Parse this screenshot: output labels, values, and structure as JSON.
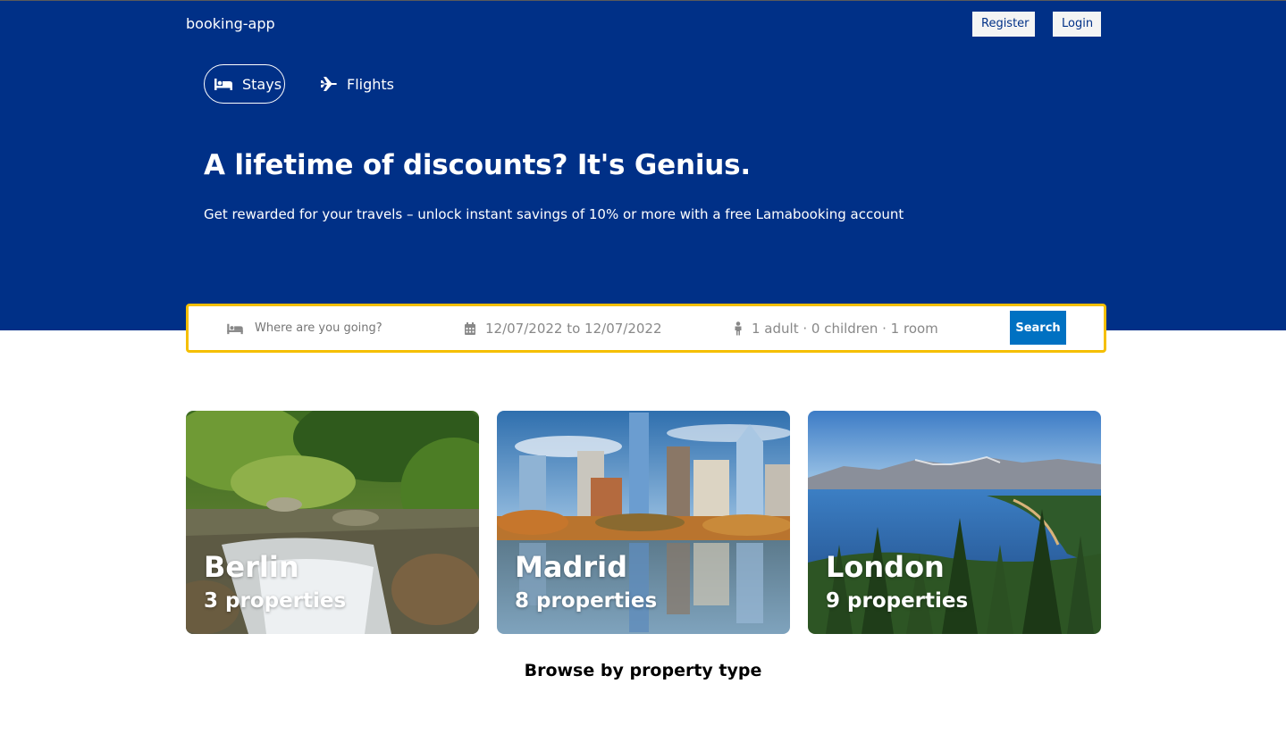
{
  "navbar": {
    "brand": "booking-app",
    "register_label": "Register",
    "login_label": "Login"
  },
  "tabs": [
    {
      "label": "Stays",
      "icon": "bed-icon",
      "active": true
    },
    {
      "label": "Flights",
      "icon": "plane-icon",
      "active": false
    }
  ],
  "hero": {
    "headline": "A lifetime of discounts? It's Genius.",
    "subheadline": "Get rewarded for your travels – unlock instant savings of 10% or more with a free Lamabooking account"
  },
  "search": {
    "destination_placeholder": "Where are you going?",
    "dates": "12/07/2022 to 12/07/2022",
    "guests": "1 adult · 0 children · 1 room",
    "button_label": "Search"
  },
  "featured": [
    {
      "city": "Berlin",
      "properties": "3 properties"
    },
    {
      "city": "Madrid",
      "properties": "8 properties"
    },
    {
      "city": "London",
      "properties": "9 properties"
    }
  ],
  "section_title": "Browse by property type",
  "colors": {
    "primary": "#003087",
    "accent": "#f5bf00",
    "button": "#0071c2"
  }
}
